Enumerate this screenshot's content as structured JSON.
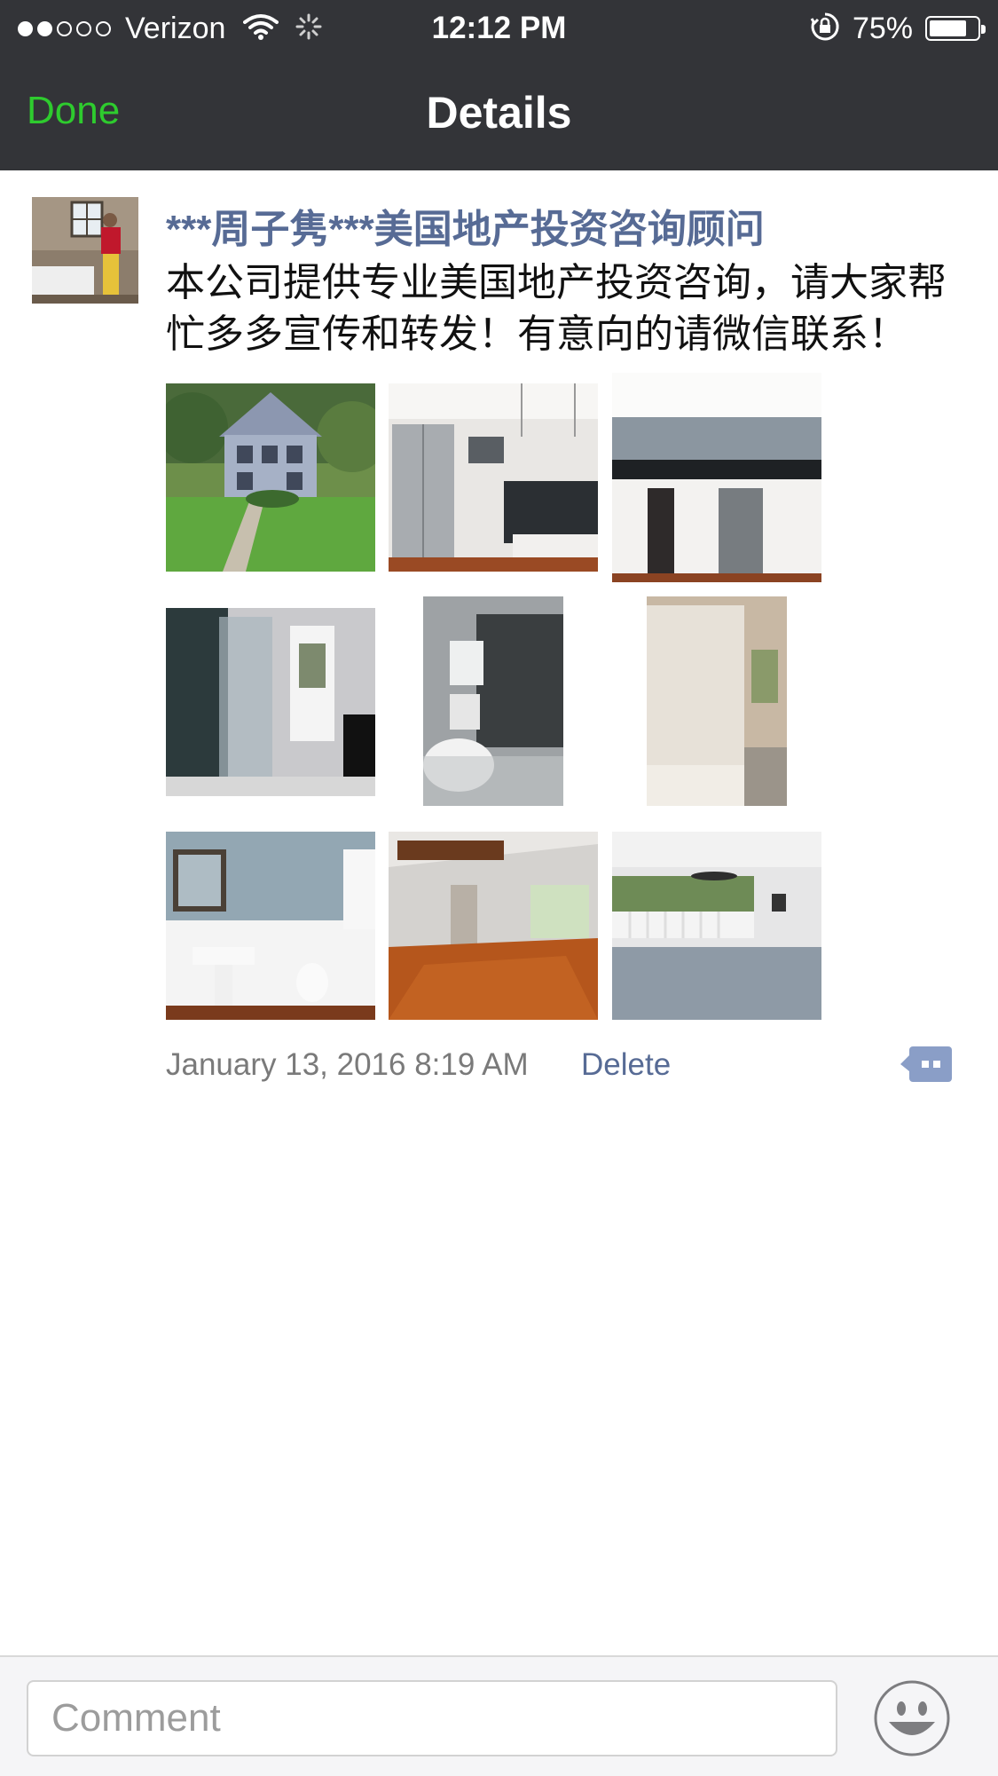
{
  "status_bar": {
    "carrier": "Verizon",
    "signal_dots_filled": 2,
    "signal_dots_total": 5,
    "time": "12:12 PM",
    "battery_percent_text": "75%",
    "battery_level": 0.75,
    "icons": [
      "wifi-icon",
      "activity-spinner-icon",
      "orientation-lock-icon",
      "battery-icon"
    ]
  },
  "nav": {
    "done_label": "Done",
    "title": "Details"
  },
  "post": {
    "author": "***周子隽***美国地产投资咨询顾问",
    "text": "本公司提供专业美国地产投资咨询，请大家帮忙多多宣传和转发！有意向的请微信联系！",
    "photos": [
      {
        "name": "photo-house-exterior"
      },
      {
        "name": "photo-kitchen-island"
      },
      {
        "name": "photo-kitchen-counter"
      },
      {
        "name": "photo-glass-shower"
      },
      {
        "name": "photo-shower-corner"
      },
      {
        "name": "photo-bathtub"
      },
      {
        "name": "photo-bathroom-sink"
      },
      {
        "name": "photo-living-room"
      },
      {
        "name": "photo-sunroom"
      }
    ],
    "timestamp": "January 13, 2016 8:19 AM",
    "delete_label": "Delete"
  },
  "comment_bar": {
    "placeholder": "Comment",
    "emoji_icon": "smiley-face-icon"
  },
  "colors": {
    "bar_background": "#333438",
    "done_green": "#2ecb2e",
    "link_blue": "#576b95"
  }
}
